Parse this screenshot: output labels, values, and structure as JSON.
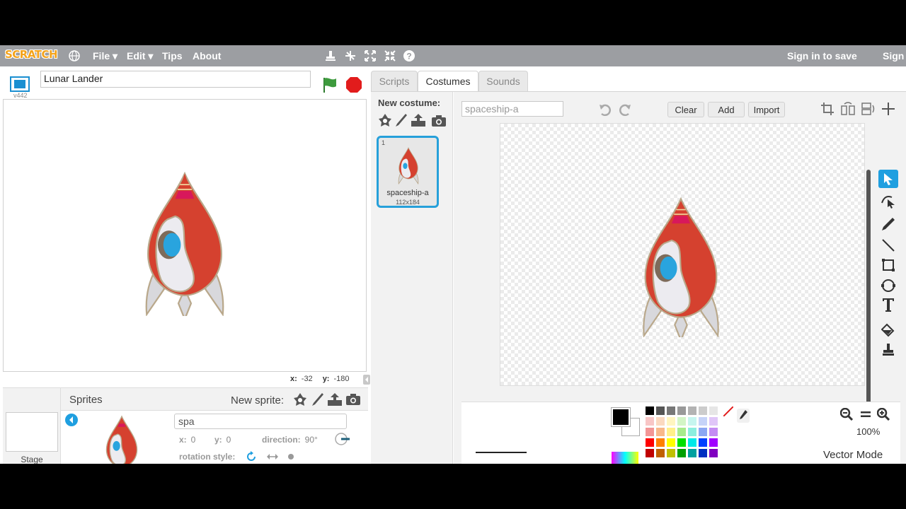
{
  "menubar": {
    "logo": "SCRATCH",
    "items": [
      "File ▾",
      "Edit ▾",
      "Tips",
      "About"
    ],
    "sign_in_to_save": "Sign in to save",
    "sign": "Sign"
  },
  "stage": {
    "project_title": "Lunar Lander",
    "version": "v442",
    "coords": {
      "x_label": "x:",
      "x": "-32",
      "y_label": "y:",
      "y": "-180"
    }
  },
  "sprites": {
    "stage_label": "Stage",
    "title": "Sprites",
    "new_sprite_label": "New sprite:",
    "selected": {
      "name": "spa",
      "x_label": "x:",
      "x": "0",
      "y_label": "y:",
      "y": "0",
      "direction_label": "direction:",
      "direction": "90°",
      "rotation_style_label": "rotation style:"
    }
  },
  "tabs": [
    "Scripts",
    "Costumes",
    "Sounds"
  ],
  "active_tab": "Costumes",
  "costumes": {
    "new_costume_label": "New costume:",
    "items": [
      {
        "index": "1",
        "name": "spaceship-a",
        "size": "112x184"
      }
    ]
  },
  "editor": {
    "costume_name": "spaceship-a",
    "buttons": {
      "clear": "Clear",
      "add": "Add",
      "import": "Import"
    },
    "zoom": "100%",
    "mode": "Vector Mode"
  },
  "colors": {
    "accent": "#1f9fe0",
    "rocket_red": "#d5412f",
    "menubar": "#9c9ea2"
  },
  "palette": [
    [
      "#000000",
      "#555555",
      "#777777",
      "#999999",
      "#b3b3b3",
      "#cccccc",
      "#e6e6e6"
    ],
    [
      "#f8c6c6",
      "#fbd9c0",
      "#fff5c0",
      "#d3f5c6",
      "#c6f5ef",
      "#c6d3f8",
      "#e0c6f8"
    ],
    [
      "#f39696",
      "#f8b88a",
      "#fff08a",
      "#a7eb8c",
      "#8ceedf",
      "#8ca7f3",
      "#c48cf3"
    ],
    [
      "#ff0000",
      "#ff8000",
      "#ffff00",
      "#00e000",
      "#00e8e8",
      "#0040ff",
      "#a000ff"
    ],
    [
      "#c00000",
      "#c06000",
      "#c0c000",
      "#00a000",
      "#00a0a0",
      "#0030c0",
      "#8000c0"
    ]
  ]
}
